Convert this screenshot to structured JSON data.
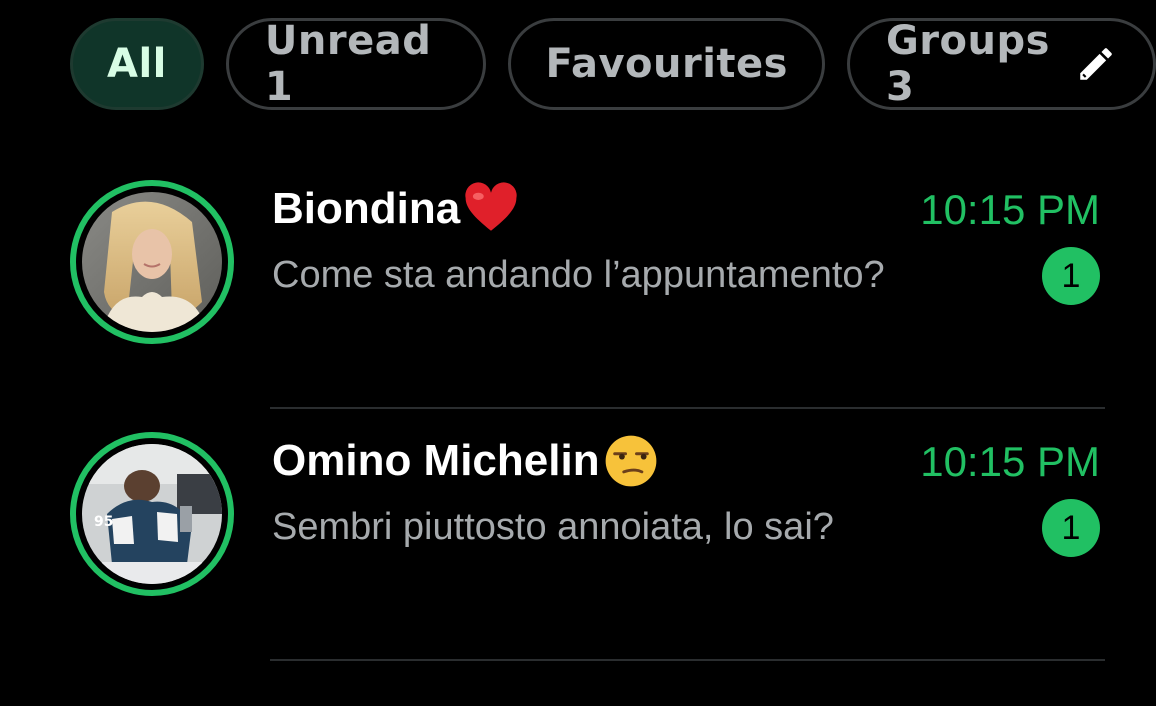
{
  "filters": {
    "all": "All",
    "unread": "Unread 1",
    "favourites": "Favourites",
    "groups": "Groups 3"
  },
  "chats": [
    {
      "name": "Biondina",
      "emoji": "red-heart-emoji",
      "time": "10:15 PM",
      "preview": "Come sta andando l’appuntamento?",
      "unread": "1"
    },
    {
      "name": "Omino Michelin",
      "emoji": "unamused-face-emoji",
      "time": "10:15 PM",
      "preview": "Sembri piuttosto annoiata, lo sai?",
      "unread": "1"
    }
  ],
  "colors": {
    "accent": "#21c063",
    "background": "#000000",
    "active_chip": "#103529",
    "chip_border": "#3a3d3f",
    "name_text": "#ffffff",
    "preview_text": "#a6aaad"
  }
}
